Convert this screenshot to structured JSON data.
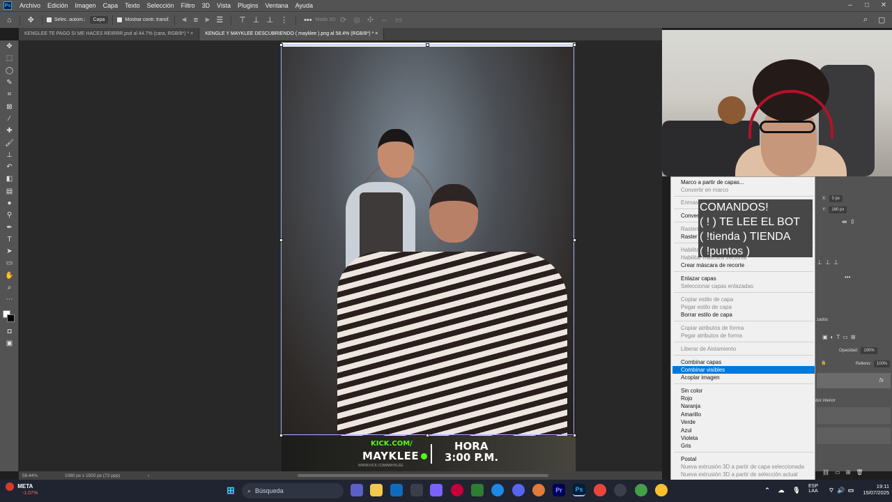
{
  "menubar": {
    "logo": "Ps",
    "items": [
      "Archivo",
      "Edición",
      "Imagen",
      "Capa",
      "Texto",
      "Selección",
      "Filtro",
      "3D",
      "Vista",
      "Plugins",
      "Ventana",
      "Ayuda"
    ],
    "window_controls": [
      "–",
      "□",
      "✕"
    ]
  },
  "options_bar": {
    "auto_select_label": "Selec. autom.:",
    "auto_select_target": "Capa",
    "show_transform_label": "Mostrar contr. transf.",
    "mode_3d_label": "Modo 3D:"
  },
  "tabs": [
    {
      "label": "KENGLEE TE PAGO SI ME HACES REIRRR.psd al 44.7% (cara, RGB/8*) *",
      "active": false
    },
    {
      "label": "KENGLE Y MAYKLEE DESCUBRIENDO ( mayklee ).png al 58.4% (RGB/8*) *",
      "active": true
    }
  ],
  "banner": {
    "kick": "KICK.COM/",
    "name": "MAYKLEE",
    "url": "WWW.KICK.COM/MAYKLEE",
    "hora": "HORA",
    "time": "3:00 P.M."
  },
  "context_menu": {
    "items": [
      {
        "label": "Marco a partir de capas...",
        "disabled": false
      },
      {
        "label": "Convertir en marco",
        "disabled": true
      },
      {
        "label": "Enmasc",
        "disabled": true
      },
      {
        "label": "Conver",
        "disabled": false
      },
      {
        "label": "Rasteri",
        "disabled": true
      },
      {
        "label": "Raster",
        "disabled": false
      },
      {
        "label": "Habilita",
        "disabled": true
      },
      {
        "label": "Habilitar máscara vectorial",
        "disabled": true
      },
      {
        "label": "Crear máscara de recorte",
        "disabled": false
      },
      {
        "label": "Enlazar capas",
        "disabled": false
      },
      {
        "label": "Seleccionar capas enlazadas",
        "disabled": true
      },
      {
        "label": "Copiar estilo de capa",
        "disabled": true
      },
      {
        "label": "Pegar estilo de capa",
        "disabled": true
      },
      {
        "label": "Borrar estilo de capa",
        "disabled": false
      },
      {
        "label": "Copiar atributos de forma",
        "disabled": true
      },
      {
        "label": "Pegar atributos de forma",
        "disabled": true
      },
      {
        "label": "Liberar de Aislamiento",
        "disabled": true
      },
      {
        "label": "Combinar capas",
        "disabled": false
      },
      {
        "label": "Combinar visibles",
        "disabled": false,
        "highlighted": true
      },
      {
        "label": "Acoplar imagen",
        "disabled": false
      },
      {
        "label": "Sin color",
        "disabled": false
      },
      {
        "label": "Rojo",
        "disabled": false
      },
      {
        "label": "Naranja",
        "disabled": false
      },
      {
        "label": "Amarillo",
        "disabled": false
      },
      {
        "label": "Verde",
        "disabled": false
      },
      {
        "label": "Azul",
        "disabled": false
      },
      {
        "label": "Violeta",
        "disabled": false
      },
      {
        "label": "Gris",
        "disabled": false
      },
      {
        "label": "Postal",
        "disabled": false
      },
      {
        "label": "Nueva extrusión 3D a partir de capa seleccionada",
        "disabled": true
      },
      {
        "label": "Nueva extrusión 3D a partir de selección actual",
        "disabled": true
      }
    ]
  },
  "overlay": {
    "lines": [
      "COMANDOS!",
      "( ! ) TE LEE EL BOT",
      "( !tienda ) TIENDA",
      "( !puntos )"
    ]
  },
  "right_panel": {
    "x_label": "X:",
    "x_value": "0 px",
    "y_label": "Y:",
    "y_value": "180 px",
    "more_glyph": "•••",
    "layers_tab_fragment": "zados",
    "opacity_label": "Opacidad:",
    "opacity_value": "100%",
    "fill_label": "Relleno:",
    "fill_value": "100%",
    "fx_label": "fx",
    "layer_fragment": "dor interior"
  },
  "status": {
    "zoom": "58.44%",
    "doc_size": "1080 px x 1920 px (72 ppp)",
    "arrow": "›"
  },
  "taskbar": {
    "weather_name": "META",
    "weather_value": "-1.07%",
    "search_placeholder": "Búsqueda",
    "lang_top": "ESP",
    "lang_bottom": "LAA",
    "time": "19:11",
    "date": "15/07/2025",
    "app_labels": {
      "premiere": "Pr",
      "photoshop": "Ps"
    },
    "colors": {
      "ps_blue": "#31a8ff",
      "kick_green": "#53fc18",
      "highlight": "#0078d7"
    }
  }
}
